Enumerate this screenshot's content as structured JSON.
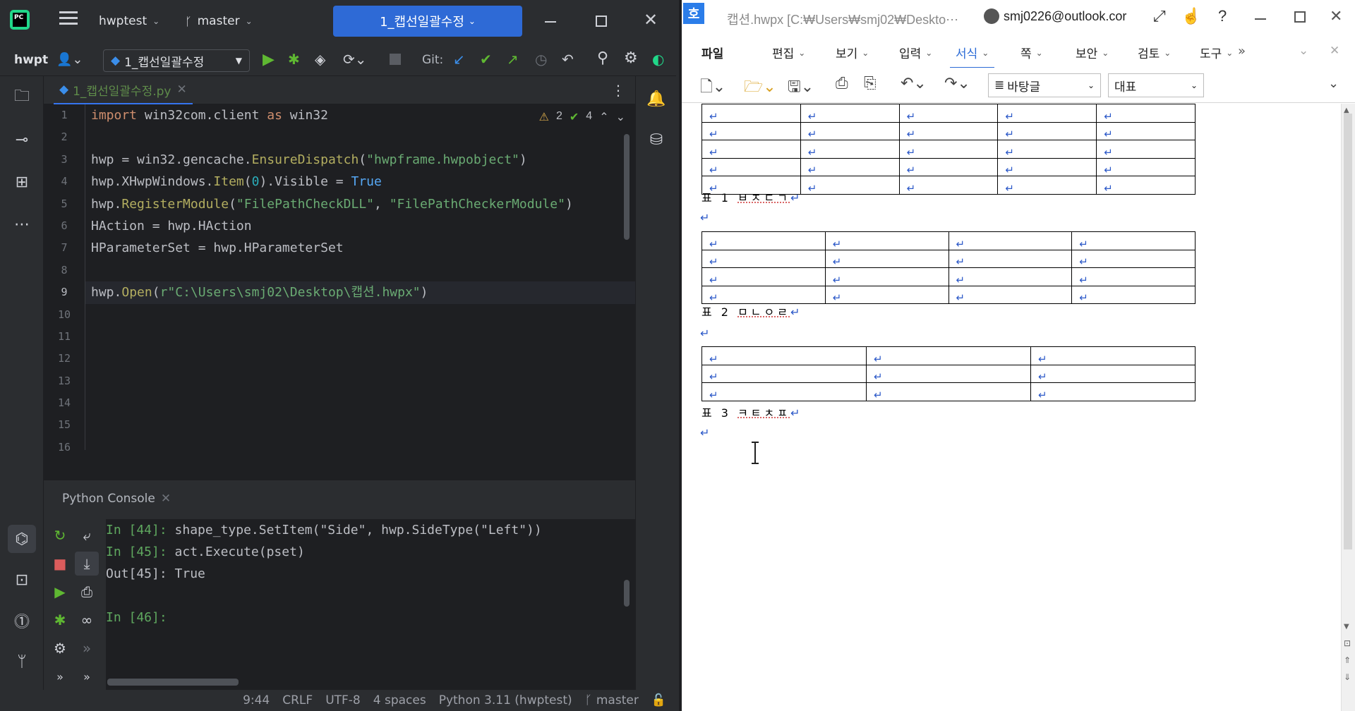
{
  "ide": {
    "project": "hwptest",
    "branch": "master",
    "run_config_tab": "1_캡선일괄수정",
    "toolbar_project": "hwpt",
    "run_config": "1_캡선일괄수정",
    "git_label": "Git:",
    "file_tab": "1_캡선일괄수정.py",
    "inspection_warnings": "2",
    "inspection_ok": "4",
    "line_numbers": [
      "1",
      "2",
      "3",
      "4",
      "5",
      "6",
      "7",
      "8",
      "9",
      "10",
      "11",
      "12",
      "13",
      "14",
      "15",
      "16"
    ],
    "console_title": "Python Console",
    "console_lines": [
      {
        "prompt": "In [44]: ",
        "text": "shape_type.SetItem(\"Side\", hwp.SideType(\"Left\"))"
      },
      {
        "prompt": "In [45]: ",
        "text": "act.Execute(pset)"
      },
      {
        "prompt": "",
        "text": "Out[45]: True"
      },
      {
        "prompt": "",
        "text": ""
      },
      {
        "prompt": "In [46]: ",
        "text": ""
      }
    ],
    "status": {
      "position": "9:44",
      "line_sep": "CRLF",
      "encoding": "UTF-8",
      "indent": "4 spaces",
      "interpreter": "Python 3.11 (hwptest)",
      "branch": "master"
    },
    "colors": {
      "accent": "#2e6ad6",
      "keyword": "#cf8e6d",
      "string": "#6aab73",
      "method": "#b3ae60"
    }
  },
  "code": {
    "l1_kw1": "import",
    "l1_mod": " win32com.client ",
    "l1_kw2": "as",
    "l1_alias": " win32",
    "l3_a": "hwp = win32.gencache.",
    "l3_fn": "EnsureDispatch",
    "l3_p1": "(",
    "l3_str": "\"hwpframe.hwpobject\"",
    "l3_p2": ")",
    "l4_a": "hwp.XHwpWindows.",
    "l4_fn": "Item",
    "l4_p1": "(",
    "l4_num": "0",
    "l4_p2": ").Visible = ",
    "l4_kw": "True",
    "l5_a": "hwp.",
    "l5_fn": "RegisterModule",
    "l5_p1": "(",
    "l5_s1": "\"FilePathCheckDLL\"",
    "l5_c": ", ",
    "l5_s2": "\"FilePathCheckerModule\"",
    "l5_p2": ")",
    "l6": "HAction = hwp.HAction",
    "l7": "HParameterSet = hwp.HParameterSet",
    "l9_a": "hwp.",
    "l9_fn": "Open",
    "l9_p1": "(",
    "l9_str": "r\"C:\\Users\\smj02\\Desktop\\캡션.hwpx\"",
    "l9_p2": ")"
  },
  "hwp": {
    "app_icon": "호",
    "title": "캡션.hwpx [C:₩Users₩smj02₩Deskto⋯",
    "account": "smj0226@outlook.cor",
    "menu": [
      "파일",
      "편집",
      "보기",
      "입력",
      "서식",
      "쪽",
      "보안",
      "검토",
      "도구"
    ],
    "active_menu": "서식",
    "style_combo": "바탕글",
    "font_combo": "대표",
    "para_mark": "↵",
    "captions": [
      {
        "label": "표 1 ",
        "text": "ㅂㅈㄷㄱ"
      },
      {
        "label": "표 2 ",
        "text": "ㅁㄴㅇㄹ"
      },
      {
        "label": "표 3 ",
        "text": "ㅋㅌㅊㅍ"
      }
    ],
    "tables": [
      {
        "rows": 5,
        "cols": 5
      },
      {
        "rows": 4,
        "cols": 4
      },
      {
        "rows": 3,
        "cols": 3
      }
    ]
  }
}
